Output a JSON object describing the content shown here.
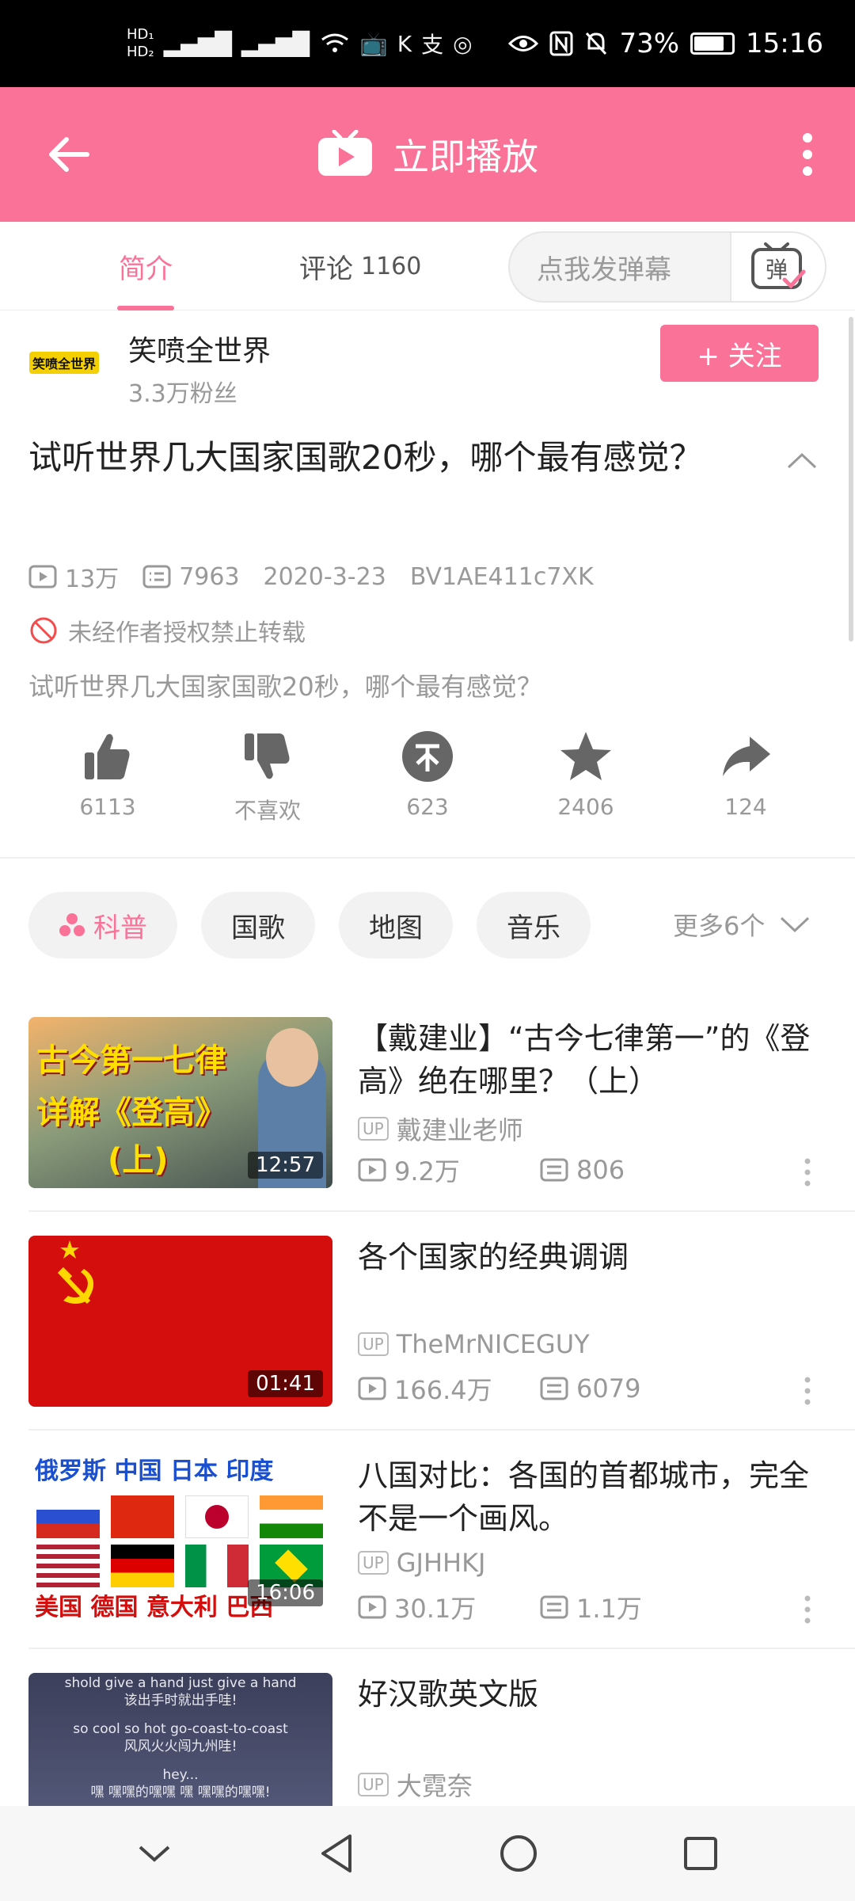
{
  "status_bar": {
    "hd1": "HD₁",
    "hd2": "HD₂",
    "signal": "4G 4G",
    "battery": "73%",
    "time": "15:16"
  },
  "header": {
    "title": "立即播放"
  },
  "tabs": {
    "intro": "简介",
    "comments_label": "评论",
    "comments_count": "1160",
    "danmaku_placeholder": "点我发弹幕",
    "danmaku_icon_text": "弹"
  },
  "uploader": {
    "avatar_text": "笑喷全世界",
    "name": "笑喷全世界",
    "fans": "3.3万粉丝",
    "follow_label": "+ 关注"
  },
  "video": {
    "title": "试听世界几大国家国歌20秒，哪个最有感觉？",
    "views": "13万",
    "danmaku": "7963",
    "date": "2020-3-23",
    "bvid": "BV1AE411c7XK",
    "copyright": "未经作者授权禁止转载",
    "description": "试听世界几大国家国歌20秒，哪个最有感觉？"
  },
  "actions": {
    "like": "6113",
    "dislike": "不喜欢",
    "coin": "623",
    "favorite": "2406",
    "share": "124"
  },
  "tags": {
    "items": [
      "科普",
      "国歌",
      "地图",
      "音乐"
    ],
    "more": "更多6个"
  },
  "related": [
    {
      "title": "【戴建业】“古今七律第一”的《登高》绝在哪里？（上）",
      "thumb_text_1": "古今第一七律",
      "thumb_text_2": "详解《登高》",
      "thumb_text_3": "(上)",
      "duration": "12:57",
      "up_badge": "UP",
      "up": "戴建业老师",
      "views": "9.2万",
      "danmaku": "806"
    },
    {
      "title": "各个国家的经典调调",
      "duration": "01:41",
      "up_badge": "UP",
      "up": "TheMrNICEGUY",
      "views": "166.4万",
      "danmaku": "6079"
    },
    {
      "title": "八国对比：各国的首都城市，完全不是一个画风。",
      "thumb_top": "俄罗斯 中国 日本 印度",
      "thumb_bottom": "美国 德国 意大利 巴西",
      "duration": "16:06",
      "up_badge": "UP",
      "up": "GJHHKJ",
      "views": "30.1万",
      "danmaku": "1.1万"
    },
    {
      "title": "好汉歌英文版",
      "thumb_l1": "shold give a hand just give a hand",
      "thumb_l2": "该出手时就出手哇!",
      "thumb_l3": "so cool so hot go-coast-to-coast",
      "thumb_l4": "风风火火闯九州哇!",
      "thumb_l5": "hey...",
      "thumb_l6": "嘿 嘿嘿的嘿嘿 嘿 嘿嘿的嘿嘿!",
      "up_badge": "UP",
      "up": "大霓奈"
    }
  ],
  "colors": {
    "brand": "#fb7299",
    "status_bar": "#000000",
    "muted": "#999999"
  }
}
